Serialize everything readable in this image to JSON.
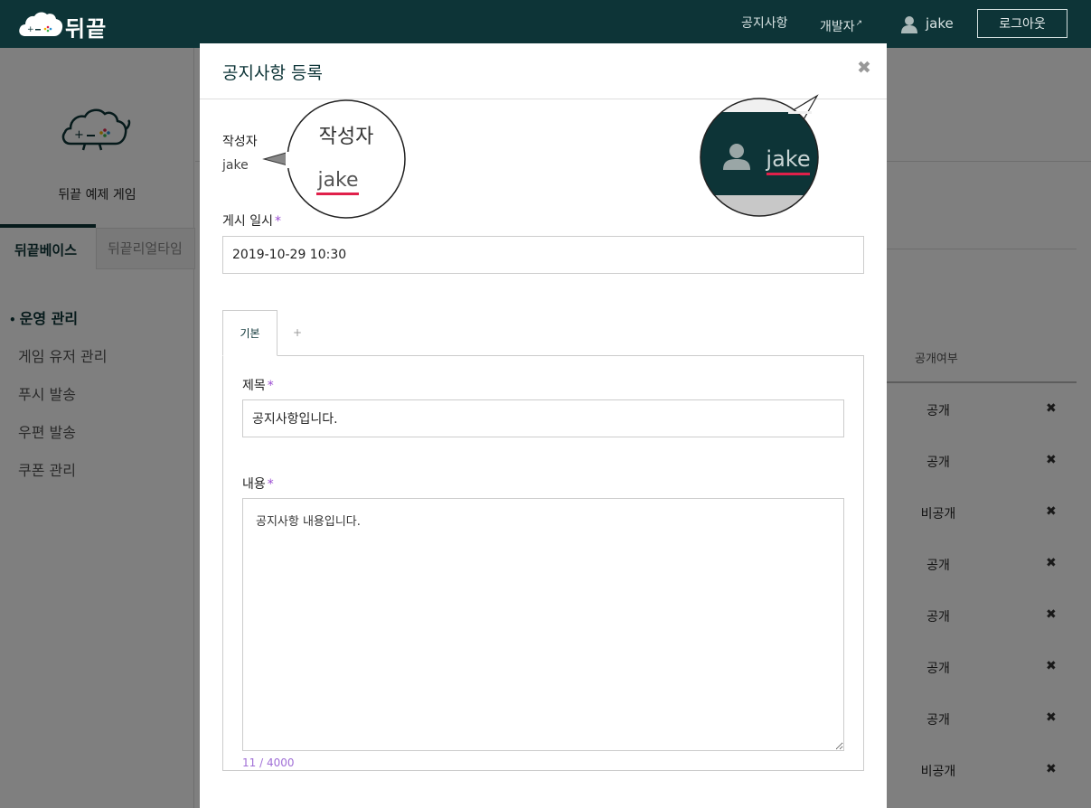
{
  "topbar": {
    "brand": "뒤끝",
    "nav_notice": "공지사항",
    "nav_developer": "개발자",
    "nav_developer_ext": "↗",
    "username": "jake",
    "logout": "로그아웃"
  },
  "sidebar": {
    "game_name": "뒤끝 예제 게임",
    "tabs": [
      "뒤끝베이스",
      "뒤끝리얼타임"
    ],
    "menu": [
      {
        "label": "운영 관리",
        "active": true
      },
      {
        "label": "게임 유저 관리",
        "active": false
      },
      {
        "label": "푸시 발송",
        "active": false
      },
      {
        "label": "우편 발송",
        "active": false
      },
      {
        "label": "쿠폰 관리",
        "active": false
      }
    ],
    "bullet": "•"
  },
  "table": {
    "column_public": "공개여부",
    "rows": [
      "공개",
      "공개",
      "비공개",
      "공개",
      "공개",
      "공개",
      "공개",
      "비공개"
    ],
    "delete_glyph": "✖"
  },
  "modal": {
    "title": "공지사항 등록",
    "close_glyph": "✖",
    "author_label": "작성자",
    "author_value": "jake",
    "post_date_label": "게시 일시",
    "post_date_value": "2019-10-29 10:30",
    "required_mark": "*",
    "lang_tabs": {
      "active": "기본",
      "add": "+"
    },
    "subject_label": "제목",
    "subject_value": "공지사항입니다.",
    "content_label": "내용",
    "content_value": "공지사항 내용입니다.",
    "char_counter": "11 / 4000"
  },
  "callouts": {
    "left_heading": "작성자",
    "left_value": "jake",
    "right_value": "jake"
  },
  "colors": {
    "header_bg": "#0d3437",
    "accent": "#0d3437",
    "required": "#9a4bd1",
    "highlight_underline": "#e0204a"
  }
}
